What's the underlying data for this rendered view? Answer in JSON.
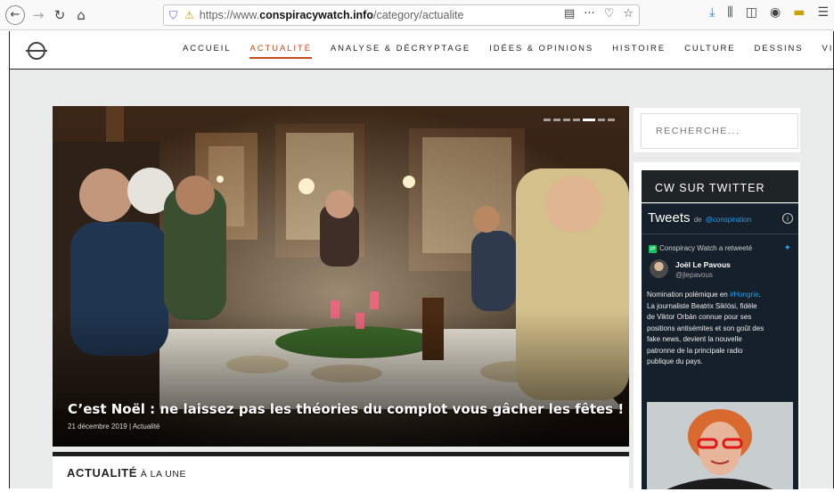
{
  "browser": {
    "url_prefix": "https://www.",
    "url_domain": "conspiracywatch.info",
    "url_path": "/category/actualite",
    "more_label": "···"
  },
  "nav": {
    "items": [
      {
        "label": "ACCUEIL",
        "active": false
      },
      {
        "label": "ACTUALITÉ",
        "active": true
      },
      {
        "label": "ANALYSE & DÉCRYPTAGE",
        "active": false
      },
      {
        "label": "IDÉES & OPINIONS",
        "active": false
      },
      {
        "label": "HISTOIRE",
        "active": false
      },
      {
        "label": "CULTURE",
        "active": false
      },
      {
        "label": "DESSINS",
        "active": false
      },
      {
        "label": "VIDÉOS",
        "active": false
      }
    ]
  },
  "hero": {
    "title": "C’est Noël : ne laissez pas les théories du complot vous gâcher les fêtes !",
    "date": "21 décembre 2019",
    "separator": "|",
    "category": "Actualité",
    "slide_count": 7,
    "active_slide": 5
  },
  "section": {
    "title_bold": "ACTUALITÉ",
    "title_rest": "À LA UNE"
  },
  "sidebar": {
    "search_placeholder": "RECHERCHE...",
    "twitter_title": "CW SUR TWITTER",
    "tweets_label": "Tweets",
    "tweets_by": "de",
    "tweets_handle": "@conspiration",
    "retweet_text": "Conspiracy Watch a retweeté",
    "author_name": "Joël Le Pavous",
    "author_handle": "@jlepavous",
    "tweet_lines": [
      {
        "text": "Nomination polémique en ",
        "link": "#Hongrie",
        "after": "."
      },
      {
        "text": "La journaliste Beatrix Siklósi, fidèle",
        "link": "",
        "after": ""
      },
      {
        "text": "de Viktor Orbán connue pour ses",
        "link": "",
        "after": ""
      },
      {
        "text": "positions antisémites et son goût des",
        "link": "",
        "after": ""
      },
      {
        "text": "fake news, devient la nouvelle",
        "link": "",
        "after": ""
      },
      {
        "text": "patronne de la principale radio",
        "link": "",
        "after": ""
      },
      {
        "text": "publique du pays.",
        "link": "",
        "after": ""
      }
    ]
  },
  "colors": {
    "accent": "#c44a1a",
    "twitter_bg": "#15202b",
    "twitter_link": "#1da1f2",
    "widget_title_bg": "#1e2426"
  }
}
